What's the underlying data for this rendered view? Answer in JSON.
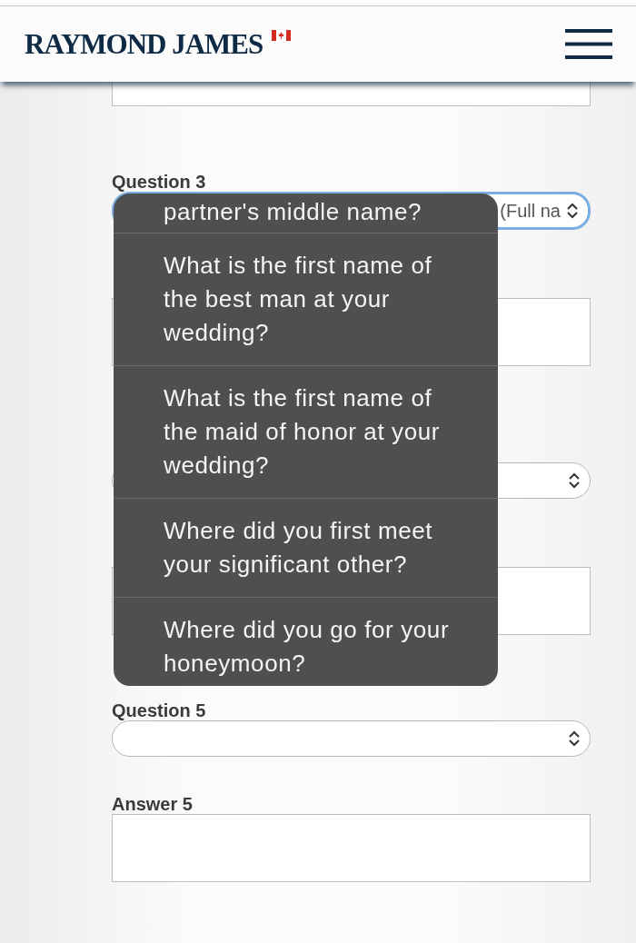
{
  "header": {
    "logo": "RAYMOND JAMES"
  },
  "form": [
    {
      "kind": "text",
      "cut": true
    },
    {
      "kind": "select",
      "label": "Question 3",
      "value": "(Full na",
      "focused": true
    },
    {
      "kind": "text",
      "cut": false
    },
    {
      "kind": "select",
      "focused": false
    },
    {
      "kind": "text",
      "cut": false
    },
    {
      "kind": "select",
      "label": "Question 5",
      "focused": false
    },
    {
      "kind": "text",
      "label": "Answer 5",
      "cut": false
    }
  ],
  "picker": {
    "options": [
      "partner's middle name?",
      "What is the first name of the best man at your wedding?",
      "What is the first name of the maid of honor at your wedding?",
      "Where did you first meet your significant other?",
      "Where did you go for your honeymoon?"
    ]
  }
}
